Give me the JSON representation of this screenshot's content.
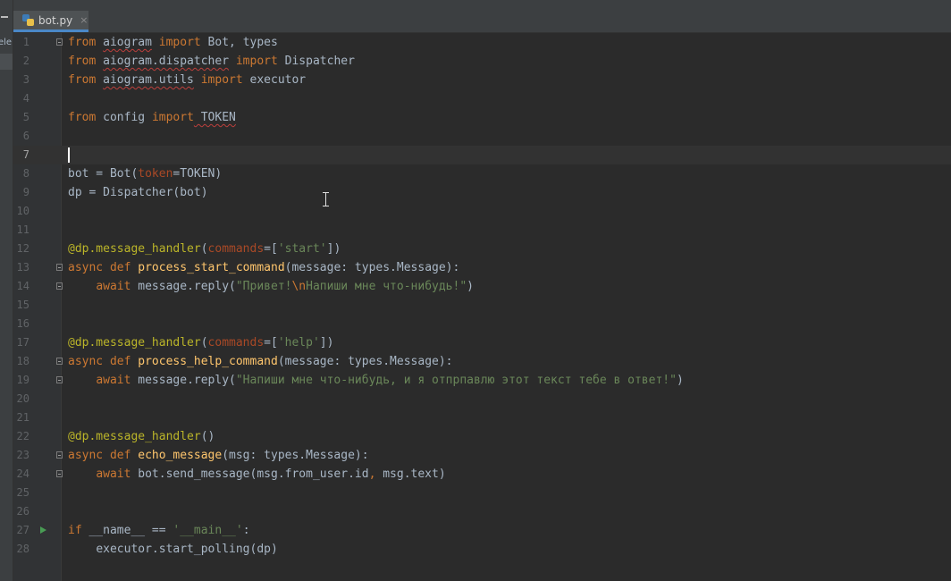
{
  "sidebar": {
    "label": "ele"
  },
  "tabs": [
    {
      "label": "bot.py",
      "icon": "python-file-icon",
      "close": "×"
    }
  ],
  "colors": {
    "keyword": "#cc7832",
    "function": "#ffc66d",
    "string": "#6a8759",
    "decorator": "#bbb529",
    "param": "#aa4926",
    "text": "#a9b7c6"
  },
  "editor": {
    "current_line": 7,
    "lines": [
      {
        "n": "1"
      },
      {
        "n": "2"
      },
      {
        "n": "3"
      },
      {
        "n": "4"
      },
      {
        "n": "5"
      },
      {
        "n": "6"
      },
      {
        "n": "7"
      },
      {
        "n": "8"
      },
      {
        "n": "9"
      },
      {
        "n": "10"
      },
      {
        "n": "11"
      },
      {
        "n": "12"
      },
      {
        "n": "13"
      },
      {
        "n": "14"
      },
      {
        "n": "15"
      },
      {
        "n": "16"
      },
      {
        "n": "17"
      },
      {
        "n": "18"
      },
      {
        "n": "19"
      },
      {
        "n": "20"
      },
      {
        "n": "21"
      },
      {
        "n": "22"
      },
      {
        "n": "23"
      },
      {
        "n": "24"
      },
      {
        "n": "25"
      },
      {
        "n": "26"
      },
      {
        "n": "27"
      },
      {
        "n": "28"
      }
    ],
    "tokens": {
      "from": "from",
      "import": "import",
      "async": "async",
      "def": "def",
      "await": "await",
      "if": "if",
      "aiogram": "aiogram",
      "bot_types": " Bot, types",
      "aiogram_dispatcher": "aiogram.dispatcher",
      "dispatcher": " Dispatcher",
      "aiogram_utils": "aiogram.utils",
      "executor": " executor",
      "config": "config",
      "token": " TOKEN",
      "l8_a": "bot = Bot(",
      "l8_p": "token",
      "l8_b": "=TOKEN)",
      "l9": "dp = Dispatcher(bot)",
      "dec_handler": "@dp.message_handler",
      "paren_open": "(",
      "paren_close": ")",
      "commands": "commands",
      "eq_bracket": "=[",
      "bracket_close": "])",
      "start_str": "'start'",
      "help_str": "'help'",
      "fn_start": "process_start_command",
      "fn_help": "process_help_command",
      "fn_echo": "echo_message",
      "sig_message": "(message: types.Message):",
      "sig_msg": "(msg: types.Message):",
      "reply_call": " message.reply(",
      "s14_a": "\"Привет!",
      "s14_esc": "\\n",
      "s14_b": "Напиши мне что-нибудь!\"",
      "s19": "\"Напиши мне что-нибудь, и я отпрпавлю этот текст тебе в ответ!\"",
      "send_a": " bot.send_message(msg.from_user.id",
      "comma": ",",
      "send_b": " msg.text)",
      "if_rest": " __name__ == ",
      "main_str": "'__main__'",
      "colon": ":",
      "polling": "executor.start_polling(dp)"
    }
  }
}
